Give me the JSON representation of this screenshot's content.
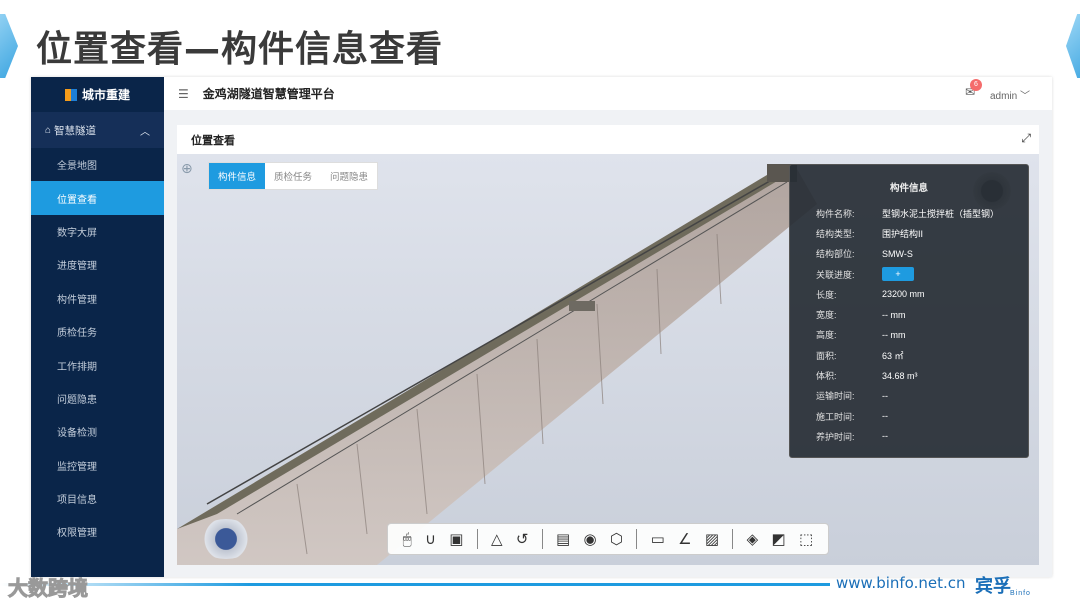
{
  "slide": {
    "title": "位置查看—构件信息查看"
  },
  "sidebar": {
    "logo": "城市重建",
    "group": {
      "label": "智慧隧道"
    },
    "items": [
      {
        "label": "全景地图"
      },
      {
        "label": "位置查看"
      },
      {
        "label": "数字大屏"
      },
      {
        "label": "进度管理"
      },
      {
        "label": "构件管理"
      },
      {
        "label": "质检任务"
      },
      {
        "label": "工作排期"
      },
      {
        "label": "问题隐患"
      },
      {
        "label": "设备检测"
      },
      {
        "label": "监控管理"
      },
      {
        "label": "项目信息"
      },
      {
        "label": "权限管理"
      }
    ]
  },
  "header": {
    "platform": "金鸡湖隧道智慧管理平台",
    "mail_count": "6",
    "user": "admin"
  },
  "panel": {
    "title": "位置查看",
    "tabs": [
      {
        "label": "构件信息"
      },
      {
        "label": "质检任务"
      },
      {
        "label": "问题隐患"
      }
    ]
  },
  "info": {
    "title": "构件信息",
    "rows": [
      {
        "key": "构件名称:",
        "value": "型钢水泥土搅拌桩（插型钢）"
      },
      {
        "key": "结构类型:",
        "value": "围护结构II"
      },
      {
        "key": "结构部位:",
        "value": "SMW-S"
      },
      {
        "key": "关联进度:",
        "value": "+"
      },
      {
        "key": "长度:",
        "value": "23200 mm"
      },
      {
        "key": "宽度:",
        "value": "-- mm"
      },
      {
        "key": "高度:",
        "value": "-- mm"
      },
      {
        "key": "面积:",
        "value": "63 ㎡"
      },
      {
        "key": "体积:",
        "value": "34.68 m³"
      },
      {
        "key": "运输时间:",
        "value": "--"
      },
      {
        "key": "施工时间:",
        "value": "--"
      },
      {
        "key": "养护时间:",
        "value": "--"
      }
    ]
  },
  "footer": {
    "url": "www.binfo.net.cn",
    "brand": "宾孚",
    "brand_sub": "Binfo",
    "watermark": "大数跨境"
  },
  "colors": {
    "accent": "#1e9be0",
    "sidebar": "#0a2549"
  }
}
